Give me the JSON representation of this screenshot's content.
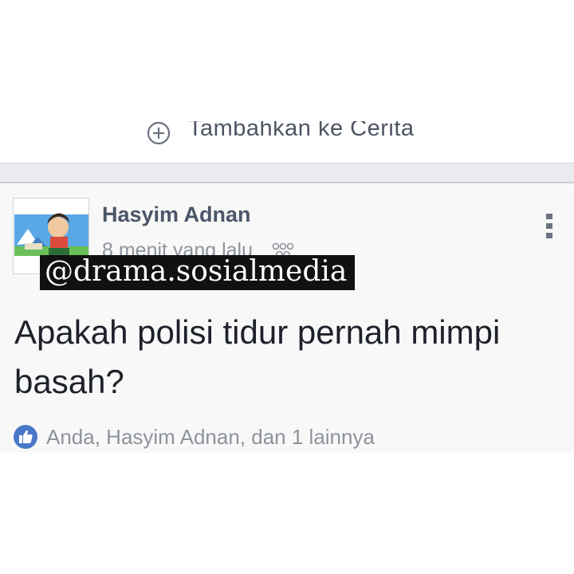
{
  "story_bar": {
    "icon": "plus-circle-icon",
    "label": "Tambahkan ke Cerita"
  },
  "post": {
    "author": "Hasyim Adnan",
    "timestamp": "8 menit yang lalu",
    "privacy_icon": "friends-icon",
    "menu_icon": "more-vertical-icon",
    "watermark": "@drama.sosialmedia",
    "text": "Apakah polisi tidur pernah mimpi basah?",
    "reactions": {
      "icon": "like-icon",
      "text": "Anda, Hasyim Adnan, dan 1 lainnya"
    }
  },
  "colors": {
    "like_blue": "#4a78c8",
    "separator": "#e9ebee",
    "name_text": "#4b5668"
  }
}
